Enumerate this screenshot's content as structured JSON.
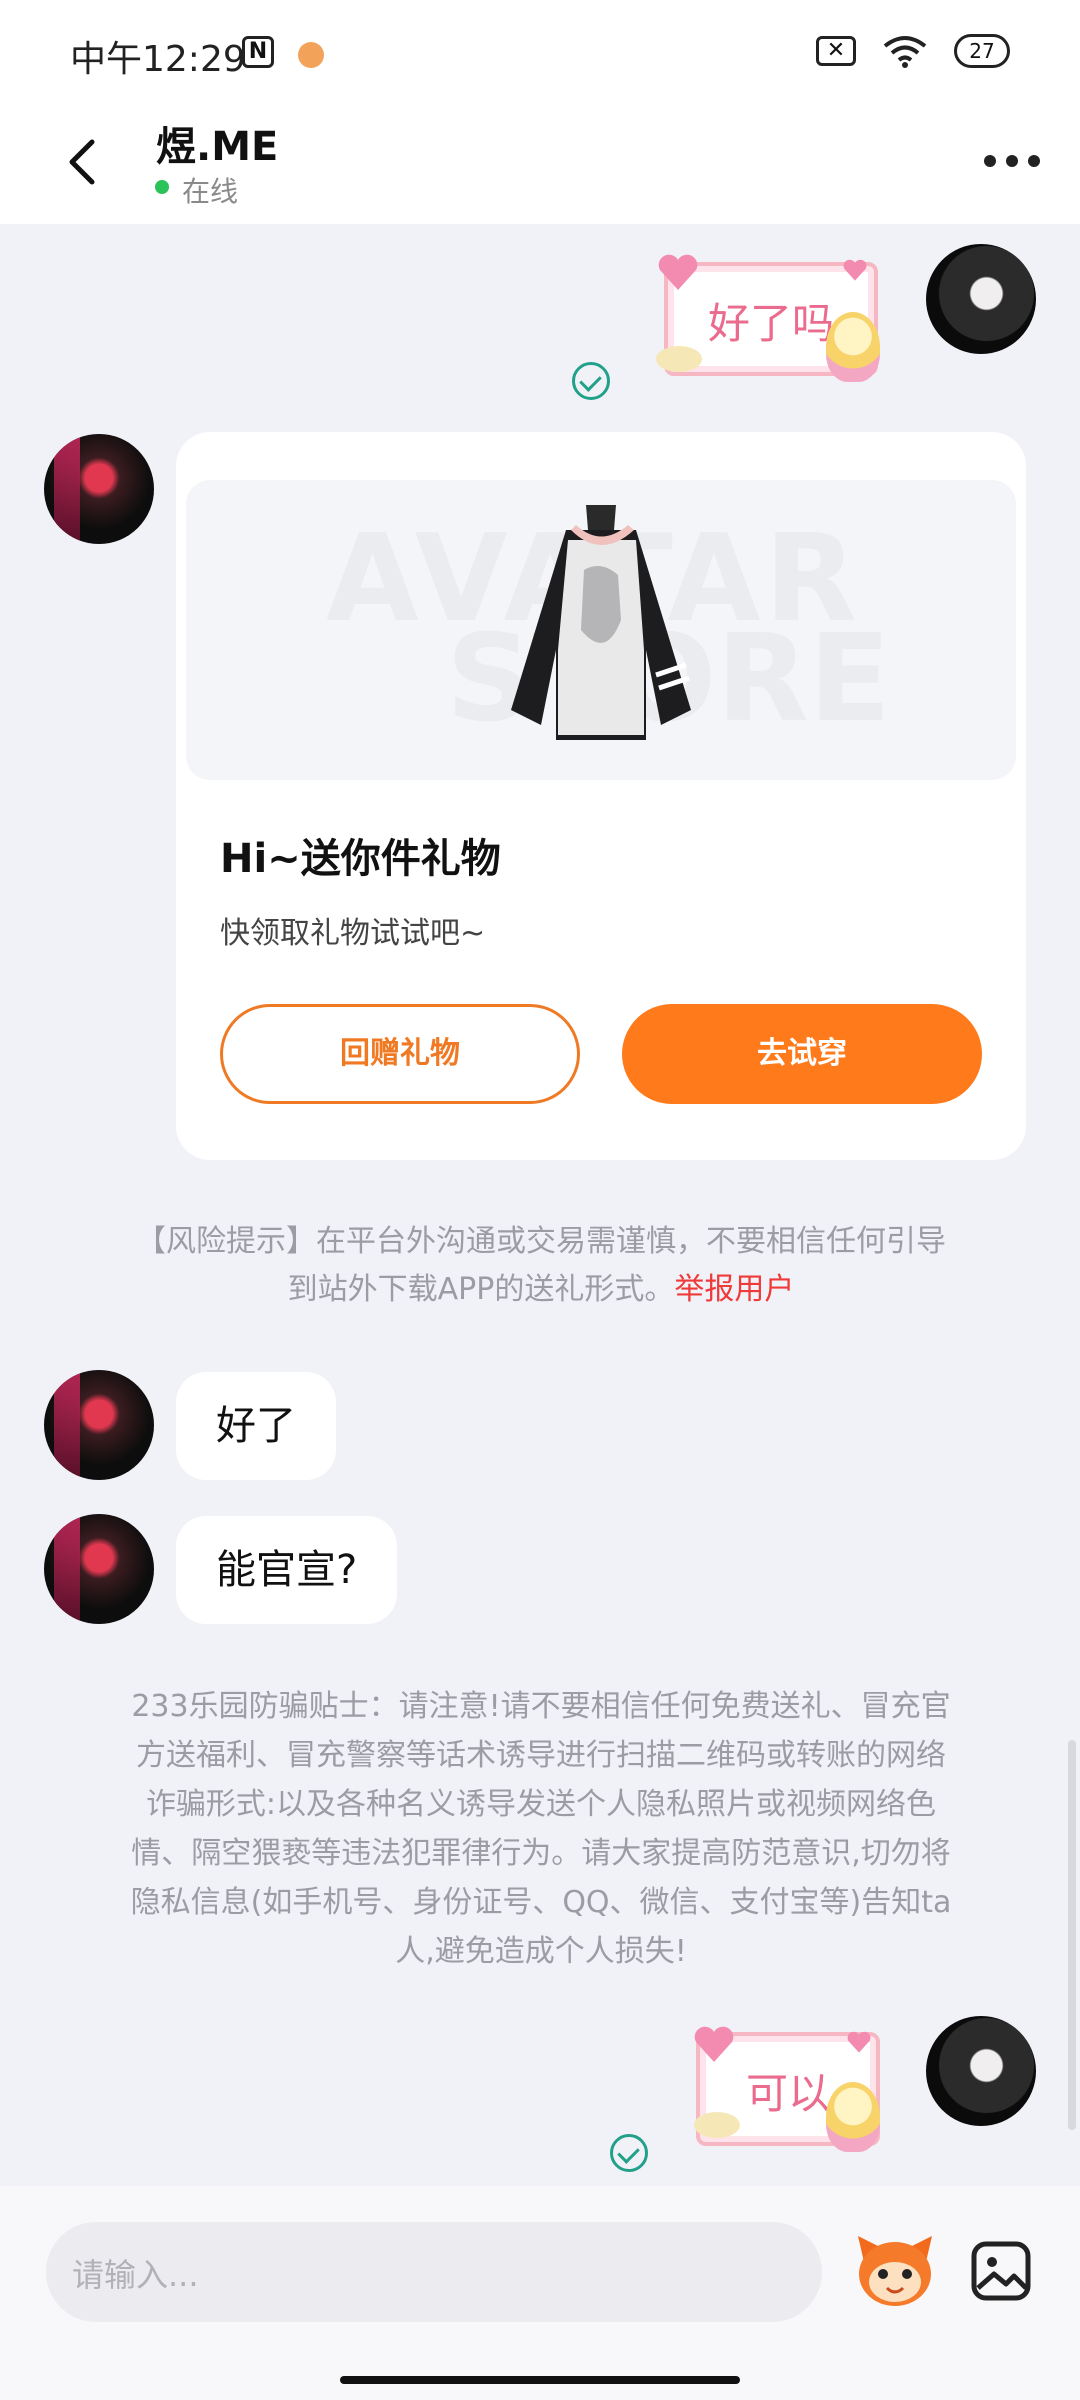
{
  "status_bar": {
    "time": "中午12:29",
    "nfc_glyph": "N",
    "x_glyph": "✕",
    "battery": "27"
  },
  "header": {
    "title": "煜.ME",
    "status": "在线"
  },
  "messages": {
    "sticker_1": "好了吗",
    "gift": {
      "watermark_line1": "AVATAR",
      "watermark_line2": "STORE",
      "title": "Hi~送你件礼物",
      "subtitle": "快领取礼物试试吧~",
      "return_gift_label": "回赠礼物",
      "try_on_label": "去试穿"
    },
    "risk_notice": {
      "text_line1": "【风险提示】在平台外沟通或交易需谨慎，不要相信任何引导",
      "text_line2": "到站外下载APP的送礼形式。",
      "report_link": "举报用户"
    },
    "bubble_1": "好了",
    "bubble_2": "能官宣?",
    "anti_fraud_tip": [
      "233乐园防骗贴士：请注意!请不要相信任何免费送礼、冒充官",
      "方送福利、冒充警察等话术诱导进行扫描二维码或转账的网络",
      "诈骗形式:以及各种名义诱导发送个人隐私照片或视频网络色",
      "情、隔空猥亵等违法犯罪律行为。请大家提高防范意识,切勿将",
      "隐私信息(如手机号、身份证号、QQ、微信、支付宝等)告知ta",
      "人,避免造成个人损失!"
    ],
    "sticker_2": "可以"
  },
  "input_bar": {
    "placeholder": "请输入..."
  },
  "icons": {
    "back": "chevron-left-icon",
    "more": "more-dots-icon",
    "sent": "check-circle-icon",
    "emoji": "mascot-emoji-icon",
    "image": "image-gallery-icon"
  },
  "colors": {
    "accent_orange": "#ff7a1a",
    "online_green": "#2bc25a",
    "report_red": "#ef3a3a",
    "sent_check": "#21a08a",
    "sticker_pink": "#ea6b8d"
  }
}
